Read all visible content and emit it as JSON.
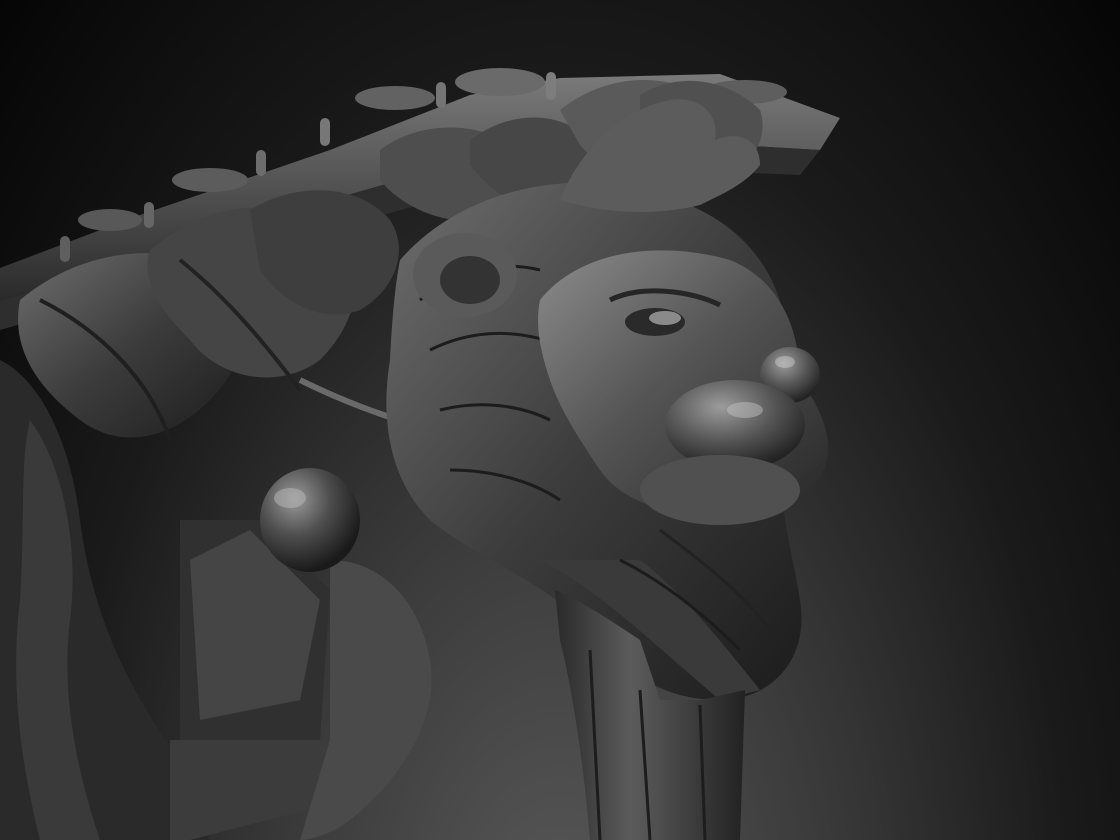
{
  "scene": {
    "subject": "sculpted-lion-table-leg-render",
    "palette": {
      "background_top": "#000000",
      "background_bottom": "#5a5a5a",
      "clay_dark": "#1e1e1e",
      "clay_mid": "#4a4a4a",
      "clay_light": "#8a8a8a",
      "highlight": "#d8d8d8"
    }
  }
}
